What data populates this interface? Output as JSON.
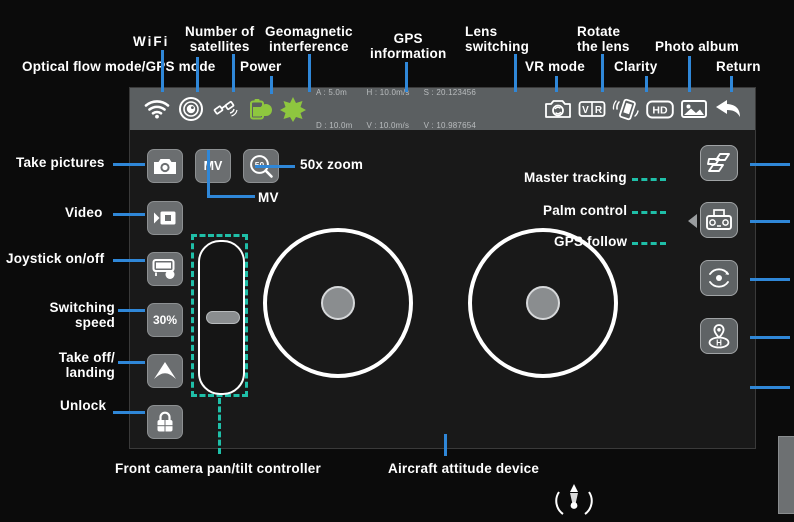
{
  "top_labels": [
    {
      "id": "optical-flow-gps-mode",
      "text": "Optical flow mode/GPS mode"
    },
    {
      "id": "wifi",
      "text": "WiFi"
    },
    {
      "id": "number-of-satellites",
      "text": "Number of\nsatellites"
    },
    {
      "id": "power",
      "text": "Power"
    },
    {
      "id": "geomagnetic-interference",
      "text": "Geomagnetic\ninterference"
    },
    {
      "id": "gps-information",
      "text": "GPS\ninformation"
    },
    {
      "id": "lens-switching",
      "text": "Lens\nswitching"
    },
    {
      "id": "vr-mode",
      "text": "VR mode"
    },
    {
      "id": "rotate-the-lens",
      "text": "Rotate\nthe lens"
    },
    {
      "id": "clarity",
      "text": "Clarity"
    },
    {
      "id": "photo-album",
      "text": "Photo album"
    },
    {
      "id": "return",
      "text": "Return"
    }
  ],
  "left_labels": [
    {
      "id": "take-pictures",
      "text": "Take pictures"
    },
    {
      "id": "video",
      "text": "Video"
    },
    {
      "id": "joystick-on-off",
      "text": "Joystick on/off"
    },
    {
      "id": "switching-speed",
      "text": "Switching\nspeed"
    },
    {
      "id": "take-off-landing",
      "text": "Take off/\nlanding"
    },
    {
      "id": "unlock",
      "text": "Unlock"
    }
  ],
  "right_labels": [
    {
      "id": "master-tracking",
      "text": "Master tracking"
    },
    {
      "id": "palm-control",
      "text": "Palm control"
    },
    {
      "id": "gps-follow",
      "text": "GPS follow"
    }
  ],
  "inline_labels": {
    "zoom_callout": "50x zoom",
    "mv_callout": "MV"
  },
  "bottom_labels": [
    {
      "id": "front-camera-pan-tilt-controller",
      "text": "Front camera pan/tilt controller"
    },
    {
      "id": "aircraft-attitude-device",
      "text": "Aircraft attitude device"
    }
  ],
  "topbar": {
    "icons": [
      {
        "name": "wifi-icon"
      },
      {
        "name": "optical-flow-gps-mode-icon"
      },
      {
        "name": "satellite-icon"
      },
      {
        "name": "battery-power-icon"
      },
      {
        "name": "geomagnetic-interference-icon"
      }
    ],
    "telemetry": {
      "col1": {
        "line1": "A : 5.0m",
        "line2": "D : 10.0m"
      },
      "col2": {
        "line1": "H : 10.0m/s",
        "line2": "V : 10.0m/s"
      },
      "col3": {
        "line1": "S : 20.123456",
        "line2": "V : 10.987654"
      }
    },
    "right_icons": [
      {
        "name": "lens-switching-icon"
      },
      {
        "name": "vr-mode-icon",
        "label": "VR"
      },
      {
        "name": "rotate-the-lens-icon"
      },
      {
        "name": "clarity-hd-icon",
        "label": "HD"
      },
      {
        "name": "photo-album-icon"
      },
      {
        "name": "return-icon"
      }
    ]
  },
  "controls": {
    "take_pictures": {
      "name": "take-pictures-button"
    },
    "mv": {
      "name": "mv-button",
      "label": "MV"
    },
    "zoom": {
      "name": "zoom-button",
      "label": "50"
    },
    "video": {
      "name": "video-button"
    },
    "joystick_toggle": {
      "name": "joystick-toggle-button"
    },
    "speed": {
      "name": "switching-speed-button",
      "label": "30%"
    },
    "takeoff": {
      "name": "take-off-landing-button"
    },
    "unlock": {
      "name": "unlock-button"
    }
  },
  "right_controls": {
    "master_tracking": {
      "name": "master-tracking-button"
    },
    "palm_control": {
      "name": "palm-control-button"
    },
    "gps_follow": {
      "name": "gps-follow-button"
    },
    "waypoint": {
      "name": "waypoint-home-button"
    }
  },
  "colors": {
    "leader_blue": "#2f87d8",
    "dash_teal": "#1fbfa8",
    "topbar_gray": "#5b5f61",
    "panel_dark": "#191919",
    "accent_green": "#8ec63f"
  }
}
